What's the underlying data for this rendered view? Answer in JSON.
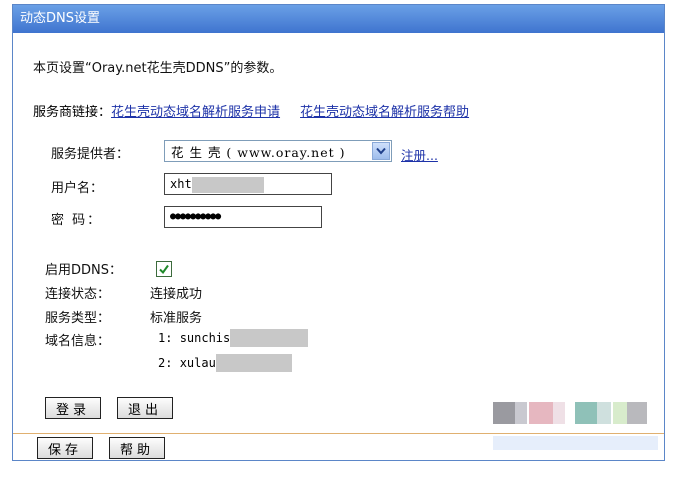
{
  "title": "动态DNS设置",
  "description": "本页设置“Oray.net花生壳DDNS”的参数。",
  "links": {
    "label": "服务商链接：",
    "apply": "花生壳动态域名解析服务申请",
    "help": "花生壳动态域名解析服务帮助"
  },
  "form": {
    "provider_label": "服务提供者：",
    "provider_value": "花 生 壳 ( www.oray.net )",
    "register_link": "注册...",
    "username_label": "用户名：",
    "username_value": "xht",
    "password_label": "密  码：",
    "password_value": "●●●●●●●●●●"
  },
  "status": {
    "enable_label": "启用DDNS：",
    "enable_checked": true,
    "connection_label": "连接状态：",
    "connection_value": "连接成功",
    "service_label": "服务类型：",
    "service_value": "标准服务",
    "domain_label": "域名信息：",
    "domains": [
      {
        "index": "1:",
        "name": "sunchis"
      },
      {
        "index": "2:",
        "name": "xulau"
      }
    ]
  },
  "buttons": {
    "login": "登录",
    "logout": "退出",
    "save": "保存",
    "help": "帮助"
  },
  "icons": {
    "dropdown": "chevron-down-icon",
    "check": "check-icon"
  },
  "colors": {
    "titlebar": "#4a7fd6",
    "link": "#1d32a8",
    "border": "#5b86c8"
  }
}
